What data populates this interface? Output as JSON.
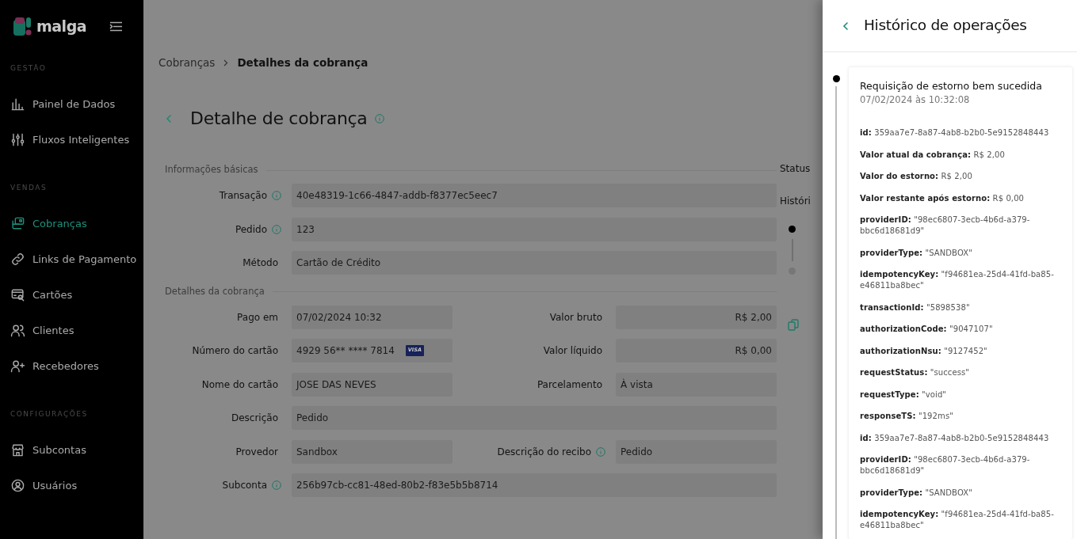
{
  "sidebar": {
    "brand": "malga",
    "sections": [
      {
        "heading": "GESTÃO",
        "items": [
          {
            "label": "Painel de Dados",
            "selected": false
          },
          {
            "label": "Fluxos Inteligentes",
            "selected": false
          }
        ]
      },
      {
        "heading": "VENDAS",
        "items": [
          {
            "label": "Cobranças",
            "selected": true
          },
          {
            "label": "Links de Pagamento",
            "selected": false
          },
          {
            "label": "Cartões",
            "selected": false
          },
          {
            "label": "Clientes",
            "selected": false
          },
          {
            "label": "Recebedores",
            "selected": false
          }
        ]
      },
      {
        "heading": "CONFIGURAÇÕES",
        "items": [
          {
            "label": "Subcontas",
            "selected": false
          },
          {
            "label": "Usuários",
            "selected": false
          }
        ]
      }
    ]
  },
  "breadcrumb": [
    {
      "label": "Cobranças",
      "current": false
    },
    {
      "label": "Detalhes da cobrança",
      "current": true
    }
  ],
  "page_title": "Detalhe de cobrança",
  "sections": [
    {
      "heading": "Informações básicas",
      "rows": [
        [
          {
            "kind": "text",
            "label": "Transação",
            "info": true,
            "value": "40e48319-1c66-4847-addb-f8377ec5eec7"
          }
        ],
        [
          {
            "kind": "text",
            "label": "Pedido",
            "info": true,
            "value": "123"
          }
        ],
        [
          {
            "kind": "text",
            "label": "Método",
            "info": false,
            "value": "Cartão de Crédito"
          }
        ]
      ]
    },
    {
      "heading": "Detalhes da cobrança",
      "rows": [
        [
          {
            "kind": "text",
            "label": "Pago em",
            "info": false,
            "value": "07/02/2024 10:32"
          },
          {
            "kind": "amount",
            "label": "Valor bruto",
            "info": false,
            "value": "R$ 2,00"
          }
        ],
        [
          {
            "kind": "card",
            "label": "Número do cartão",
            "info": false,
            "value": "4929 56** **** 7814",
            "brand": "VISA"
          },
          {
            "kind": "amount",
            "label": "Valor líquido",
            "info": false,
            "value": "R$ 0,00"
          }
        ],
        [
          {
            "kind": "text",
            "label": "Nome do cartão",
            "info": false,
            "value": "JOSE DAS NEVES"
          },
          {
            "kind": "text",
            "label": "Parcelamento",
            "info": false,
            "value": "À vista"
          }
        ],
        [
          {
            "kind": "text",
            "label": "Descrição",
            "info": false,
            "value": "Pedido"
          }
        ],
        [
          {
            "kind": "text",
            "label": "Provedor",
            "info": false,
            "value": "Sandbox"
          },
          {
            "kind": "text",
            "label": "Descrição do recibo",
            "info": true,
            "value": "Pedido"
          }
        ],
        [
          {
            "kind": "text",
            "label": "Subconta",
            "info": true,
            "value": "256b97cb-cc81-48ed-80b2-f83e5b5b8714"
          }
        ]
      ]
    }
  ],
  "side_panel": {
    "status_label": "Status",
    "history_label": "Históri",
    "timeline": [
      {
        "active": true
      },
      {
        "active": false
      }
    ]
  },
  "drawer": {
    "title": "Histórico de operações",
    "events": [
      {
        "title": "Requisição de estorno bem sucedida",
        "date": "07/02/2024 às 10:32:08",
        "active": true,
        "details": [
          "**id:** 359aa7e7-8a87-4ab8-b2b0-5e9152848443",
          "**Valor atual da cobrança:** R$ 2,00",
          "**Valor do estorno:** R$ 2,00",
          "**Valor restante após estorno:** R$ 0,00",
          "**providerID:** \"98ec6807-3ecb-4b6d-a379-bbc6d18681d9\"",
          "**providerType:** \"SANDBOX\"",
          "**idempotencyKey:** \"f94681ea-25d4-41fd-ba85-e46811ba8bec\"",
          "**transactionId:** \"5898538\"",
          "**authorizationCode:** \"9047107\"",
          "**authorizationNsu:** \"9127452\"",
          "**requestStatus:** \"success\"",
          "**requestType:** \"void\"",
          "**responseTS:** \"192ms\"",
          "**id:** 359aa7e7-8a87-4ab8-b2b0-5e9152848443",
          "**providerID:** \"98ec6807-3ecb-4b6d-a379-bbc6d18681d9\"",
          "**providerType:** \"SANDBOX\"",
          "**idempotencyKey:** \"f94681ea-25d4-41fd-ba85-e46811ba8bec\""
        ]
      }
    ]
  }
}
